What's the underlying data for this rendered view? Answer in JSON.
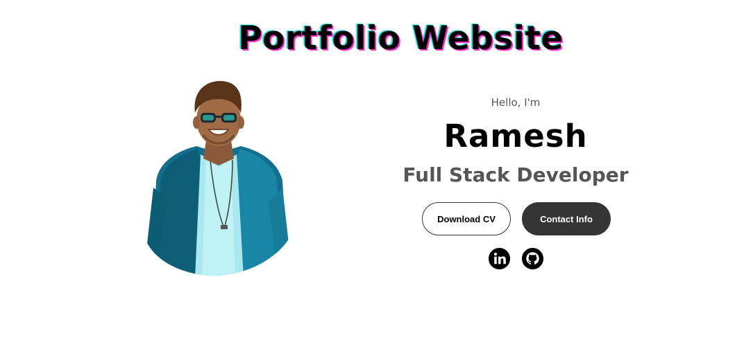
{
  "header": {
    "title": "Portfolio Website"
  },
  "profile": {
    "greeting": "Hello, I'm",
    "name": "Ramesh",
    "role": "Full Stack Developer",
    "photo_alt": "Profile photo of Ramesh"
  },
  "actions": {
    "download_cv_label": "Download CV",
    "contact_info_label": "Contact Info"
  },
  "socials": [
    {
      "icon": "linkedin-icon"
    },
    {
      "icon": "github-icon"
    }
  ],
  "colors": {
    "text": "#000000",
    "muted": "#555555",
    "button_dark": "#353535",
    "title_shadow_pink": "#ff2fd0",
    "title_shadow_cyan": "#10e0e6"
  }
}
